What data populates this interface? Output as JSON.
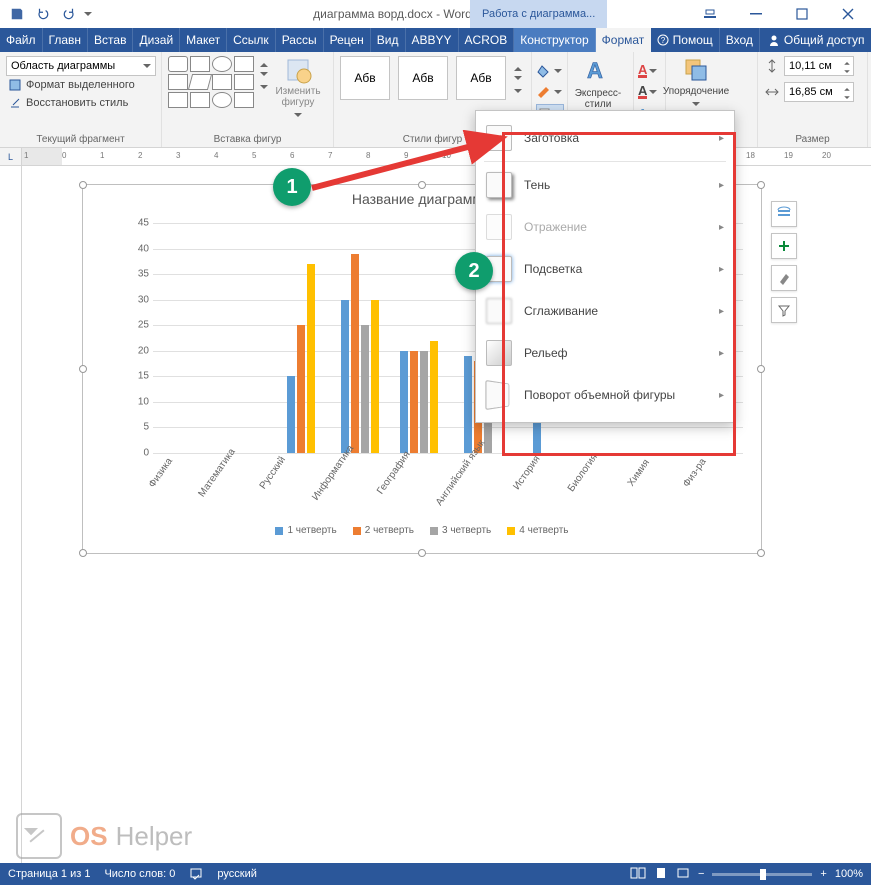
{
  "title": {
    "doc": "диаграмма ворд.docx - Word",
    "context": "Работа с диаграмма..."
  },
  "tabs": [
    "Файл",
    "Главн",
    "Встав",
    "Дизай",
    "Макет",
    "Ссылк",
    "Рассы",
    "Рецен",
    "Вид",
    "ABBYY",
    "ACROB"
  ],
  "context_tabs": {
    "ctor": "Конструктор",
    "format": "Формат"
  },
  "help": "Помощ",
  "signin": "Вход",
  "share": "Общий доступ",
  "ribbon": {
    "selector": "Область диаграммы",
    "fmt_sel": "Формат выделенного",
    "reset": "Восстановить стиль",
    "g_current": "Текущий фрагмент",
    "g_shapes": "Вставка фигур",
    "change_shape": "Изменить фигуру",
    "abv": "Абв",
    "g_styles": "Стили фигур",
    "express": "Экспресс-стили",
    "arrange": "Упорядочение",
    "g_size": "Размер",
    "height": "10,11 см",
    "width": "16,85 см"
  },
  "effects": {
    "preset": "Заготовка",
    "shadow": "Тень",
    "reflection": "Отражение",
    "glow": "Подсветка",
    "soft": "Сглаживание",
    "bevel": "Рельеф",
    "rotation": "Поворот объемной фигуры"
  },
  "chart_data": {
    "type": "bar",
    "title": "Название диаграммы",
    "ylim": [
      0,
      45
    ],
    "yticks": [
      0,
      5,
      10,
      15,
      20,
      25,
      30,
      35,
      40,
      45
    ],
    "categories": [
      "Физика",
      "Математика",
      "Русский",
      "Информатика",
      "География",
      "Английский язык",
      "История",
      "Биология",
      "Химия",
      "Физ-ра"
    ],
    "series": [
      {
        "name": "1 четверть",
        "color": "#5b9bd5",
        "values": [
          null,
          null,
          15,
          30,
          20,
          19,
          22,
          null,
          null,
          null
        ]
      },
      {
        "name": "2 четверть",
        "color": "#ed7d31",
        "values": [
          null,
          null,
          25,
          39,
          20,
          18,
          null,
          null,
          null,
          null
        ]
      },
      {
        "name": "3 четверть",
        "color": "#a5a5a5",
        "values": [
          null,
          null,
          null,
          25,
          20,
          23,
          null,
          null,
          null,
          null
        ]
      },
      {
        "name": "4 четверть",
        "color": "#ffc000",
        "values": [
          null,
          null,
          37,
          30,
          22,
          null,
          null,
          null,
          null,
          null
        ]
      }
    ]
  },
  "badges": {
    "one": "1",
    "two": "2"
  },
  "status": {
    "page": "Страница 1 из 1",
    "words": "Число слов: 0",
    "lang": "русский",
    "zoom": "100%"
  },
  "watermark": {
    "a": "OS",
    "b": "Helper"
  }
}
